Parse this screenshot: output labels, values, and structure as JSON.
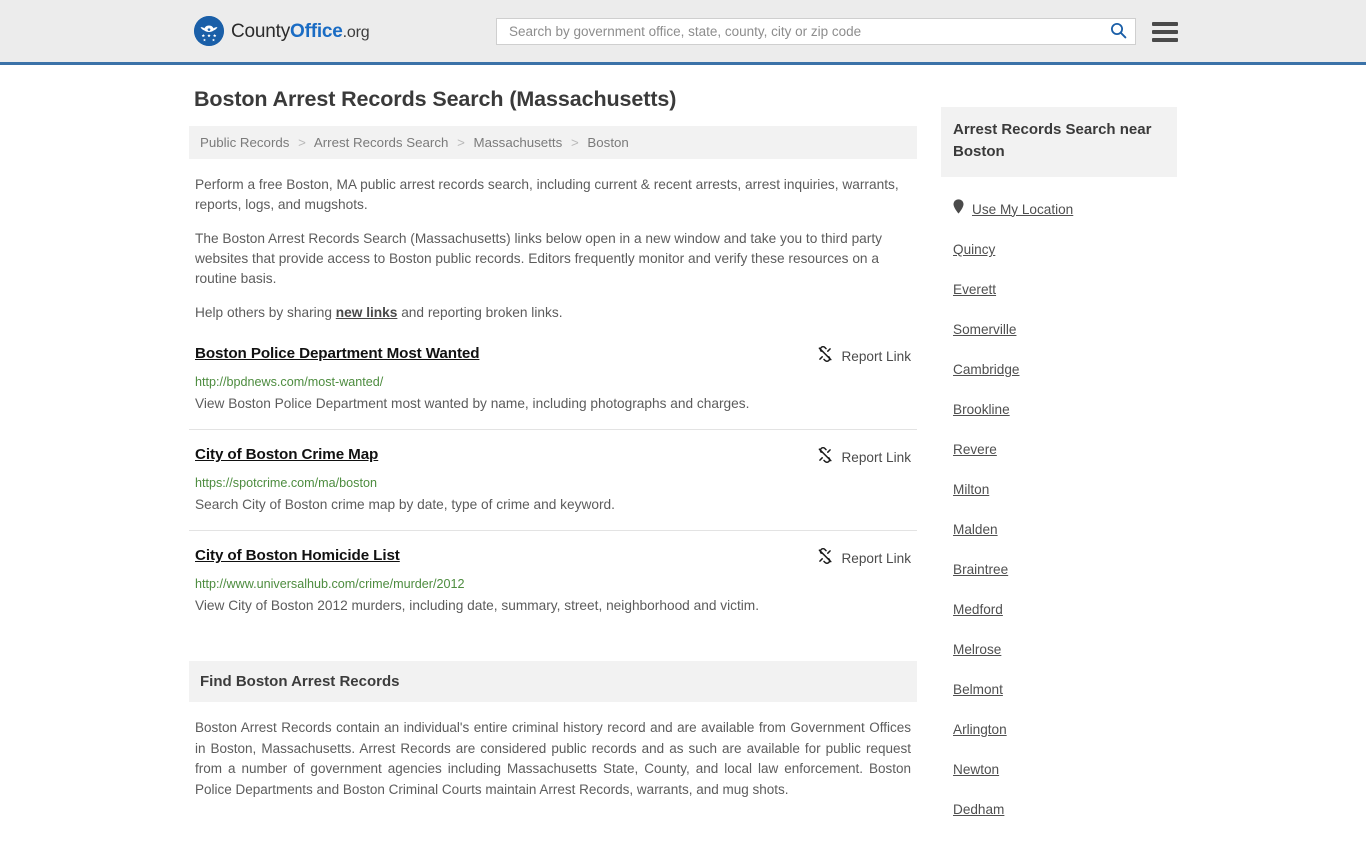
{
  "header": {
    "logo": {
      "icon": "eagle-shield-icon",
      "part1": "County",
      "part2": "Office",
      "part3": ".org"
    },
    "search": {
      "placeholder": "Search by government office, state, county, city or zip code",
      "value": "",
      "search_icon": "search-icon"
    },
    "menu_icon": "hamburger-menu-icon"
  },
  "main": {
    "title": "Boston Arrest Records Search (Massachusetts)",
    "breadcrumb": {
      "separator": ">",
      "items": [
        {
          "label": "Public Records"
        },
        {
          "label": "Arrest Records Search"
        },
        {
          "label": "Massachusetts"
        },
        {
          "label": "Boston"
        }
      ]
    },
    "intro": {
      "p1": "Perform a free Boston, MA public arrest records search, including current & recent arrests, arrest inquiries, warrants, reports, logs, and mugshots.",
      "p2": "The Boston Arrest Records Search (Massachusetts) links below open in a new window and take you to third party websites that provide access to Boston public records. Editors frequently monitor and verify these resources on a routine basis.",
      "p3_before": "Help others by sharing ",
      "p3_link": "new links",
      "p3_after": " and reporting broken links."
    },
    "report_link_label": "Report Link",
    "report_link_icon": "broken-link-icon",
    "listings": [
      {
        "title": "Boston Police Department Most Wanted",
        "url": "http://bpdnews.com/most-wanted/",
        "description": "View Boston Police Department most wanted by name, including photographs and charges."
      },
      {
        "title": "City of Boston Crime Map",
        "url": "https://spotcrime.com/ma/boston",
        "description": "Search City of Boston crime map by date, type of crime and keyword."
      },
      {
        "title": "City of Boston Homicide List",
        "url": "http://www.universalhub.com/crime/murder/2012",
        "description": "View City of Boston 2012 murders, including date, summary, street, neighborhood and victim."
      }
    ],
    "find_section": {
      "heading": "Find Boston Arrest Records",
      "body": "Boston Arrest Records contain an individual's entire criminal history record and are available from Government Offices in Boston, Massachusetts. Arrest Records are considered public records and as such are available for public request from a number of government agencies including Massachusetts State, County, and local law enforcement. Boston Police Departments and Boston Criminal Courts maintain Arrest Records, warrants, and mug shots."
    }
  },
  "sidebar": {
    "heading": "Arrest Records Search near Boston",
    "location_icon": "map-pin-icon",
    "items": [
      {
        "label": "Use My Location"
      },
      {
        "label": "Quincy"
      },
      {
        "label": "Everett"
      },
      {
        "label": "Somerville"
      },
      {
        "label": "Cambridge"
      },
      {
        "label": "Brookline"
      },
      {
        "label": "Revere"
      },
      {
        "label": "Milton"
      },
      {
        "label": "Malden"
      },
      {
        "label": "Braintree"
      },
      {
        "label": "Medford"
      },
      {
        "label": "Melrose"
      },
      {
        "label": "Belmont"
      },
      {
        "label": "Arlington"
      },
      {
        "label": "Newton"
      },
      {
        "label": "Dedham"
      }
    ]
  },
  "colors": {
    "header_bg": "#ececec",
    "header_border": "#3b72a8",
    "brand_blue": "#1a6cc4",
    "url_green": "#4d8c3f",
    "panel_gray": "#f2f2f2"
  }
}
